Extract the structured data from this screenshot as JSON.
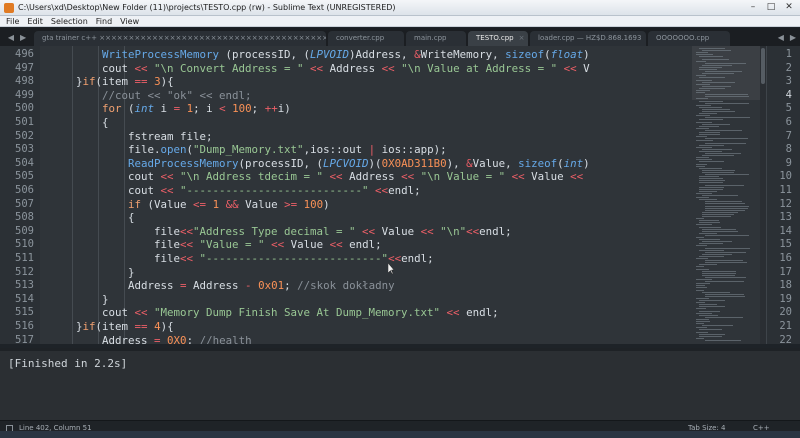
{
  "window": {
    "title": "C:\\Users\\xd\\Desktop\\New Folder (11)\\projects\\TESTO.cpp (rw) - Sublime Text (UNREGISTERED)",
    "buttons": [
      "–",
      "□",
      "✕"
    ]
  },
  "menu": [
    "File",
    "Edit",
    "Selection",
    "Find",
    "View"
  ],
  "tabs": [
    {
      "label": "gta trainer c++ ××××××××××××××××××××××××××××××××××××××××××××××××××××××××××××××××××××××",
      "active": false
    },
    {
      "label": "converter.cpp",
      "active": false
    },
    {
      "label": "main.cpp",
      "active": false
    },
    {
      "label": "TESTO.cpp",
      "active": true
    },
    {
      "label": "loader.cpp — HZ$D.868.1693",
      "active": false
    },
    {
      "label": "OOOOOOO.cpp",
      "active": false
    }
  ],
  "editor": {
    "line_numbers": [
      "496",
      "497",
      "498",
      "499",
      "500",
      "501",
      "502",
      "503",
      "504",
      "505",
      "506",
      "507",
      "508",
      "509",
      "510",
      "511",
      "512",
      "513",
      "514",
      "515",
      "516",
      "517"
    ],
    "right_line_numbers": [
      "1",
      "2",
      "3",
      "4",
      "5",
      "6",
      "7",
      "8",
      "9",
      "10",
      "11",
      "12",
      "13",
      "14",
      "15",
      "16",
      "17",
      "18",
      "19",
      "20",
      "21",
      "22"
    ],
    "lines": [
      {
        "indent": 2,
        "tokens": [
          [
            "fn",
            "WriteProcessMemory"
          ],
          [
            "plain",
            " (processID, ("
          ],
          [
            "type",
            "LPVOID"
          ],
          [
            "plain",
            ")Address, "
          ],
          [
            "op",
            "&"
          ],
          [
            "plain",
            "WriteMemory, "
          ],
          [
            "fn",
            "sizeof"
          ],
          [
            "plain",
            "("
          ],
          [
            "type",
            "float"
          ],
          [
            "plain",
            ")"
          ]
        ]
      },
      {
        "indent": 2,
        "tokens": [
          [
            "plain",
            "cout "
          ],
          [
            "op",
            "<<"
          ],
          [
            "str",
            " \"\\n Convert Address = \" "
          ],
          [
            "op",
            "<<"
          ],
          [
            "plain",
            " Address "
          ],
          [
            "op",
            "<<"
          ],
          [
            "str",
            " \"\\n Value at Address = \" "
          ],
          [
            "op",
            "<<"
          ],
          [
            "plain",
            " V"
          ]
        ]
      },
      {
        "indent": 1,
        "tokens": [
          [
            "plain",
            "}"
          ],
          [
            "kw",
            "if"
          ],
          [
            "plain",
            "(item "
          ],
          [
            "op",
            "=="
          ],
          [
            "plain",
            " "
          ],
          [
            "num",
            "3"
          ],
          [
            "plain",
            "){"
          ]
        ]
      },
      {
        "indent": 2,
        "tokens": [
          [
            "com",
            "//cout << \"ok\" << endl;"
          ]
        ]
      },
      {
        "indent": 2,
        "tokens": [
          [
            "kw",
            "for"
          ],
          [
            "plain",
            " ("
          ],
          [
            "type",
            "int"
          ],
          [
            "plain",
            " i "
          ],
          [
            "op",
            "="
          ],
          [
            "plain",
            " "
          ],
          [
            "num",
            "1"
          ],
          [
            "plain",
            "; i "
          ],
          [
            "op",
            "<"
          ],
          [
            "plain",
            " "
          ],
          [
            "num",
            "100"
          ],
          [
            "plain",
            "; "
          ],
          [
            "op",
            "++"
          ],
          [
            "plain",
            "i)"
          ]
        ]
      },
      {
        "indent": 2,
        "tokens": [
          [
            "plain",
            "{"
          ]
        ]
      },
      {
        "indent": 3,
        "tokens": [
          [
            "plain",
            "fstream file;"
          ]
        ]
      },
      {
        "indent": 3,
        "tokens": [
          [
            "plain",
            "file."
          ],
          [
            "fn",
            "open"
          ],
          [
            "plain",
            "("
          ],
          [
            "str",
            "\"Dump_Memory.txt\""
          ],
          [
            "plain",
            ",ios::out "
          ],
          [
            "op",
            "|"
          ],
          [
            "plain",
            " ios::app);"
          ]
        ]
      },
      {
        "indent": 3,
        "tokens": [
          [
            "fn",
            "ReadProcessMemory"
          ],
          [
            "plain",
            "(processID, ("
          ],
          [
            "type",
            "LPCVOID"
          ],
          [
            "plain",
            ")("
          ],
          [
            "num",
            "0X0AD311B0"
          ],
          [
            "plain",
            "), "
          ],
          [
            "op",
            "&"
          ],
          [
            "plain",
            "Value, "
          ],
          [
            "fn",
            "sizeof"
          ],
          [
            "plain",
            "("
          ],
          [
            "type",
            "int"
          ],
          [
            "plain",
            ")"
          ]
        ]
      },
      {
        "indent": 3,
        "tokens": [
          [
            "plain",
            "cout "
          ],
          [
            "op",
            "<<"
          ],
          [
            "str",
            " \"\\n Address tdecim = \" "
          ],
          [
            "op",
            "<<"
          ],
          [
            "plain",
            " Address "
          ],
          [
            "op",
            "<<"
          ],
          [
            "str",
            " \"\\n Value = \" "
          ],
          [
            "op",
            "<<"
          ],
          [
            "plain",
            " Value "
          ],
          [
            "op",
            "<<"
          ]
        ]
      },
      {
        "indent": 3,
        "tokens": [
          [
            "plain",
            "cout "
          ],
          [
            "op",
            "<<"
          ],
          [
            "str",
            " \"---------------------------\" "
          ],
          [
            "op",
            "<<"
          ],
          [
            "plain",
            "endl;"
          ]
        ]
      },
      {
        "indent": 3,
        "tokens": [
          [
            "kw",
            "if"
          ],
          [
            "plain",
            " (Value "
          ],
          [
            "op",
            "<="
          ],
          [
            "plain",
            " "
          ],
          [
            "num",
            "1"
          ],
          [
            "plain",
            " "
          ],
          [
            "op",
            "&&"
          ],
          [
            "plain",
            " Value "
          ],
          [
            "op",
            ">="
          ],
          [
            "plain",
            " "
          ],
          [
            "num",
            "100"
          ],
          [
            "plain",
            ")"
          ]
        ]
      },
      {
        "indent": 3,
        "tokens": [
          [
            "plain",
            "{"
          ]
        ]
      },
      {
        "indent": 4,
        "tokens": [
          [
            "plain",
            "file"
          ],
          [
            "op",
            "<<"
          ],
          [
            "str",
            "\"Address Type decimal = \" "
          ],
          [
            "op",
            "<<"
          ],
          [
            "plain",
            " Value "
          ],
          [
            "op",
            "<<"
          ],
          [
            "str",
            " \"\\n\""
          ],
          [
            "op",
            "<<"
          ],
          [
            "plain",
            "endl;"
          ]
        ]
      },
      {
        "indent": 4,
        "tokens": [
          [
            "plain",
            "file"
          ],
          [
            "op",
            "<<"
          ],
          [
            "plain",
            " "
          ],
          [
            "str",
            "\"Value = \" "
          ],
          [
            "op",
            "<<"
          ],
          [
            "plain",
            " Value "
          ],
          [
            "op",
            "<<"
          ],
          [
            "plain",
            " endl;"
          ]
        ]
      },
      {
        "indent": 4,
        "tokens": [
          [
            "plain",
            "file"
          ],
          [
            "op",
            "<<"
          ],
          [
            "plain",
            " "
          ],
          [
            "str",
            "\"---------------------------\""
          ],
          [
            "op",
            "<<"
          ],
          [
            "plain",
            "endl;"
          ]
        ]
      },
      {
        "indent": 3,
        "tokens": [
          [
            "plain",
            "}"
          ]
        ]
      },
      {
        "indent": 3,
        "tokens": [
          [
            "plain",
            "Address "
          ],
          [
            "op",
            "="
          ],
          [
            "plain",
            " Address "
          ],
          [
            "op",
            "-"
          ],
          [
            "plain",
            " "
          ],
          [
            "num",
            "0x01"
          ],
          [
            "plain",
            "; "
          ],
          [
            "com",
            "//skok dokładny"
          ]
        ]
      },
      {
        "indent": 2,
        "tokens": [
          [
            "plain",
            "}"
          ]
        ]
      },
      {
        "indent": 2,
        "tokens": [
          [
            "plain",
            "cout "
          ],
          [
            "op",
            "<<"
          ],
          [
            "str",
            " \"Memory Dump Finish Save At Dump_Memory.txt\" "
          ],
          [
            "op",
            "<<"
          ],
          [
            "plain",
            " endl;"
          ]
        ]
      },
      {
        "indent": 1,
        "tokens": [
          [
            "plain",
            "}"
          ],
          [
            "kw",
            "if"
          ],
          [
            "plain",
            "(item "
          ],
          [
            "op",
            "=="
          ],
          [
            "plain",
            " "
          ],
          [
            "num",
            "4"
          ],
          [
            "plain",
            "){"
          ]
        ]
      },
      {
        "indent": 2,
        "tokens": [
          [
            "plain",
            "Address "
          ],
          [
            "op",
            "="
          ],
          [
            "plain",
            " "
          ],
          [
            "num",
            "0X0"
          ],
          [
            "plain",
            "; "
          ],
          [
            "com",
            "//health"
          ]
        ]
      }
    ]
  },
  "console": {
    "message": "[Finished in 2.2s]"
  },
  "status": {
    "position": "Line 402, Column 51",
    "tab_size": "Tab Size: 4",
    "syntax": "C++"
  }
}
